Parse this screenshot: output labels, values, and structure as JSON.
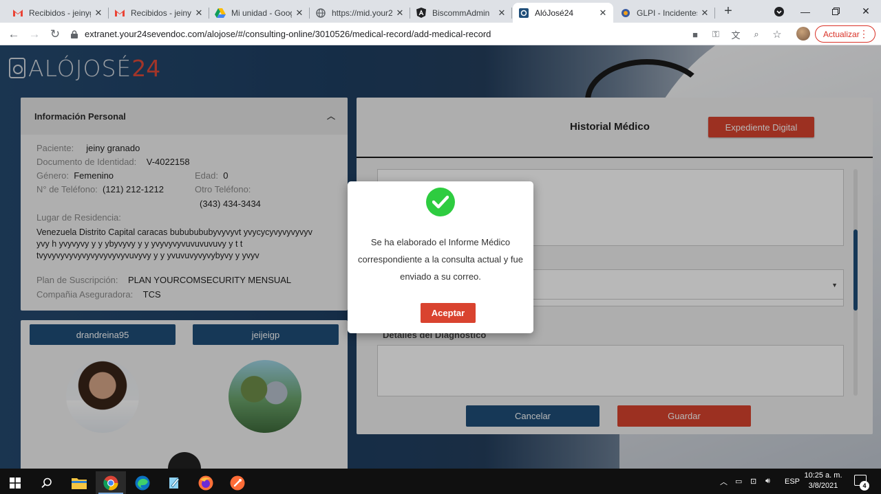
{
  "browser": {
    "tabs": [
      {
        "title": "Recibidos - jeinyg",
        "icon": "gmail-icon"
      },
      {
        "title": "Recibidos - jeinyg",
        "icon": "gmail-icon"
      },
      {
        "title": "Mi unidad - Google",
        "icon": "google-drive-icon"
      },
      {
        "title": "https://mid.your2",
        "icon": "globe-icon"
      },
      {
        "title": "BiscommAdmin",
        "icon": "angular-icon"
      },
      {
        "title": "AlóJosé24",
        "icon": "alojose-icon"
      },
      {
        "title": "GLPI - Incidentes",
        "icon": "glpi-icon"
      }
    ],
    "url": "extranet.your24sevendoc.com/alojose/#/consulting-online/3010526/medical-record/add-medical-record",
    "update_label": "Actualizar"
  },
  "page": {
    "logo_text": "ΑLÓJOSÉ",
    "logo_num": "24",
    "personal": {
      "title": "Información Personal",
      "patient_label": "Paciente:",
      "patient_value": "jeiny granado",
      "id_label": "Documento de Identidad:",
      "id_value": "V-4022158",
      "gender_label": "Género:",
      "gender_value": "Femenino",
      "age_label": "Edad:",
      "age_value": "0",
      "phone_label": "N° de Teléfono:",
      "phone_value": "(121) 212-1212",
      "other_phone_label": "Otro Teléfono:",
      "other_phone_value": "(343) 434-3434",
      "residence_label": "Lugar de Residencia:",
      "residence_value": "Venezuela Distrito Capital caracas bububububyvyvyvt yvycycyvyvyvyvyv yvy h yvyvyvy y y ybyvyvy y y yvyvyvyvuvuvuvuvy y t t tvyvyvyvyvyvyvyvyvyvyvuvyvy y y yvuvuvyvyvybyvy y yvyv",
      "plan_label": "Plan de Suscripción:",
      "plan_value": "PLAN YOURCOMSECURITY MENSUAL",
      "insurer_label": "Compañia Aseguradora:",
      "insurer_value": "TCS"
    },
    "users": {
      "doctor": "drandreina95",
      "patient": "jeijeigp"
    },
    "record": {
      "title": "Historial Médico",
      "digital_button": "Expediente Digital",
      "diagnosis_label": "Detalles del Diagnóstico",
      "cancel_button": "Cancelar",
      "save_button": "Guardar"
    },
    "modal": {
      "message": "Se ha elaborado el Informe Médico correspondiente a la consulta actual y fue enviado a su correo.",
      "ok_button": "Aceptar"
    }
  },
  "taskbar": {
    "language": "ESP",
    "time": "10:25 a. m.",
    "date": "3/8/2021",
    "notifications": "4"
  },
  "colors": {
    "brand_blue": "#1f4e79",
    "brand_red": "#d9432f",
    "success_green": "#2ecc40"
  }
}
